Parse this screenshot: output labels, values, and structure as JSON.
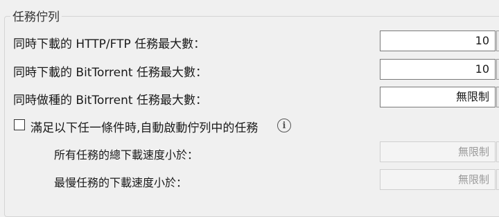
{
  "group": {
    "title": "任務佇列"
  },
  "rows": [
    {
      "label": "同時下載的 HTTP/FTP 任務最大數：",
      "value": "10"
    },
    {
      "label": "同時下載的 BitTorrent 任務最大數：",
      "value": "10"
    },
    {
      "label": "同時做種的 BitTorrent 任務最大數：",
      "value": "無限制"
    }
  ],
  "auto_start": {
    "checkbox_label": "滿足以下任一條件時,自動啟動佇列中的任務",
    "checked": false,
    "info_icon": "info-icon",
    "conditions": [
      {
        "label": "所有任務的總下載速度小於：",
        "value": "無限制"
      },
      {
        "label": "最慢任務的下載速度小於：",
        "value": "無限制"
      }
    ]
  }
}
